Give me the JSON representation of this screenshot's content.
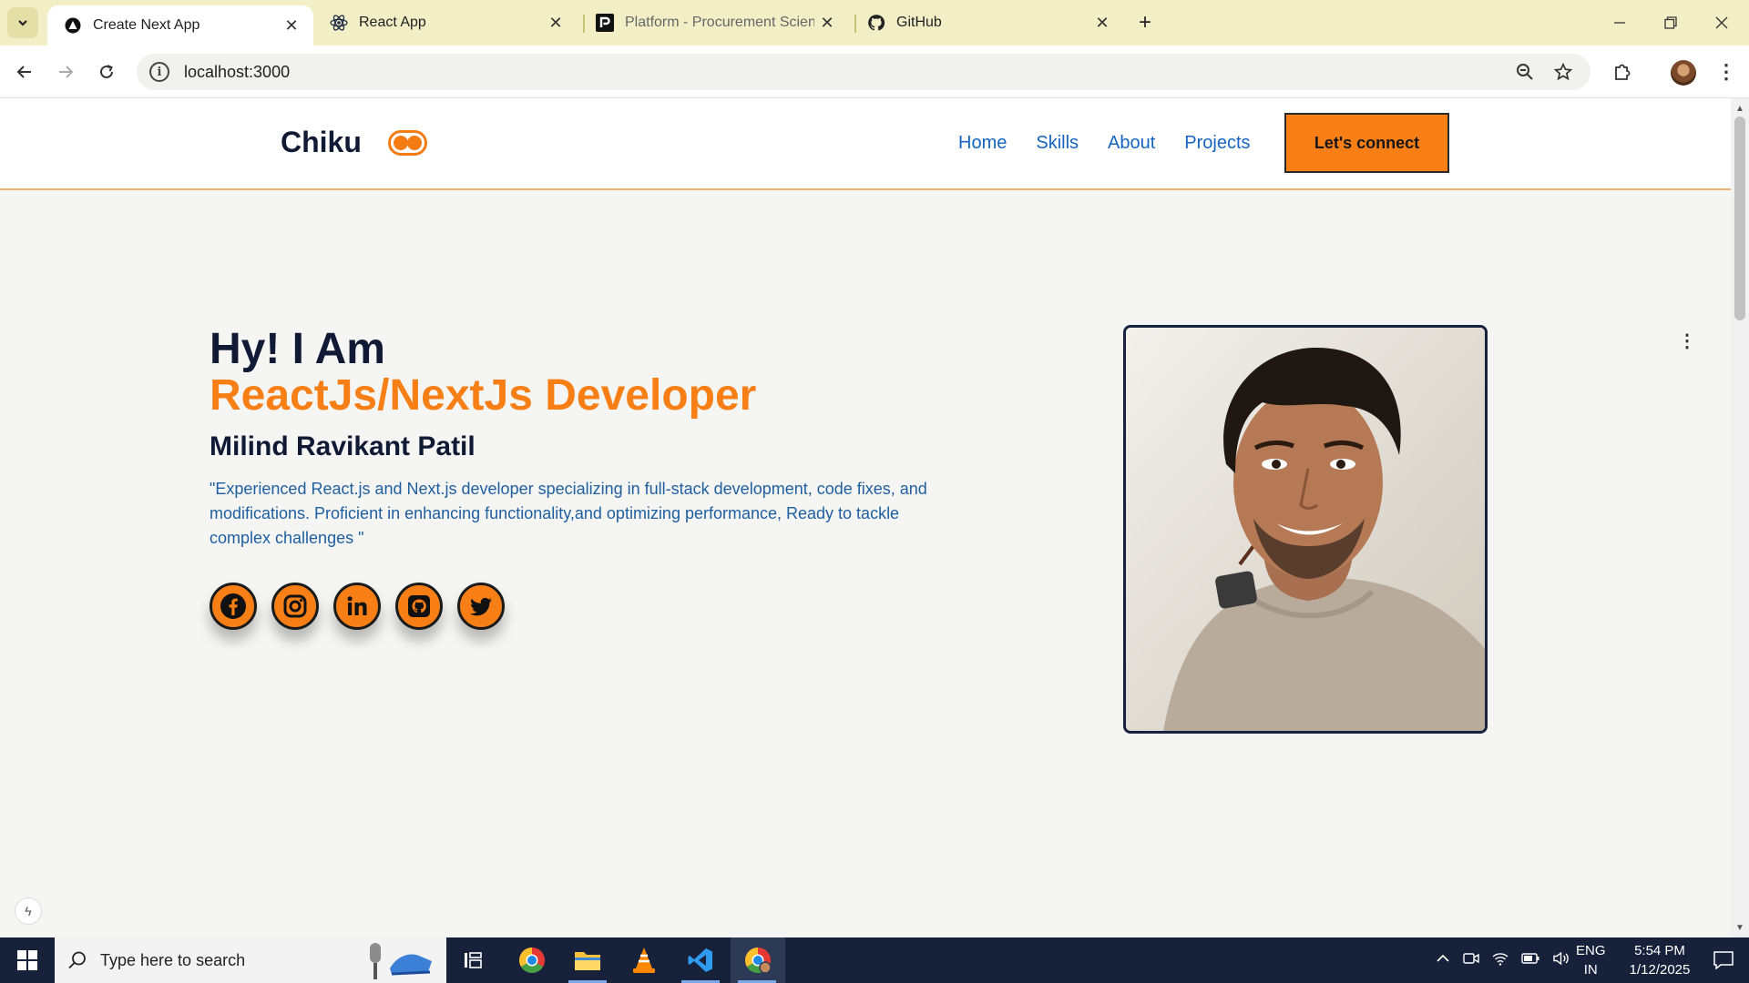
{
  "browser": {
    "tabs": [
      {
        "title": "Create Next App",
        "icon": "nextjs-icon",
        "active": true
      },
      {
        "title": "React App",
        "icon": "react-icon",
        "active": false
      },
      {
        "title": "Platform - Procurement Science",
        "icon": "platform-p-icon",
        "active": false
      },
      {
        "title": "GitHub",
        "icon": "github-icon",
        "active": false
      }
    ],
    "url": "localhost:3000"
  },
  "site": {
    "brand": "Chiku",
    "nav": [
      "Home",
      "Skills",
      "About",
      "Projects"
    ],
    "cta_label": "Let's connect"
  },
  "hero": {
    "greeting": "Hy! I Am",
    "role": "ReactJs/NextJs Developer",
    "name": "Milind Ravikant Patil",
    "description": "\"Experienced React.js and Next.js developer specializing in full-stack development, code fixes, and modifications. Proficient in enhancing functionality,and optimizing performance, Ready to tackle complex challenges \"",
    "socials": [
      "facebook-icon",
      "instagram-icon",
      "linkedin-icon",
      "github-icon",
      "twitter-icon"
    ]
  },
  "taskbar": {
    "search_placeholder": "Type here to search",
    "lang_line1": "ENG",
    "lang_line2": "IN",
    "time": "5:54 PM",
    "date": "1/12/2025"
  },
  "colors": {
    "accent": "#f77f16",
    "navy": "#111a35",
    "link": "#1565c0",
    "tabstrip": "#f2efc6"
  }
}
